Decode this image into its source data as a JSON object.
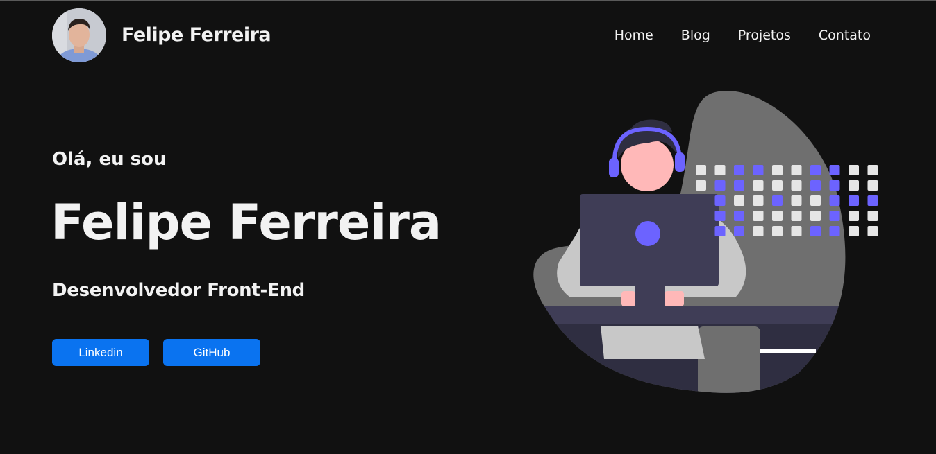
{
  "header": {
    "avatar_icon": "profile-photo",
    "brand": "Felipe Ferreira",
    "nav": [
      {
        "label": "Home"
      },
      {
        "label": "Blog"
      },
      {
        "label": "Projetos"
      },
      {
        "label": "Contato"
      }
    ]
  },
  "hero": {
    "greeting": "Olá, eu sou",
    "name": "Felipe Ferreira",
    "role": "Desenvolvedor Front-End",
    "buttons": [
      {
        "label": "Linkedin"
      },
      {
        "label": "GitHub"
      }
    ],
    "illustration_icon": "developer-at-computer-illustration"
  },
  "colors": {
    "background": "#111111",
    "text": "#f2f2f2",
    "button": "#0a73f0",
    "accent_purple": "#6c63ff",
    "illustration_gray": "#6f6f6f",
    "illustration_dark": "#3f3d56"
  }
}
